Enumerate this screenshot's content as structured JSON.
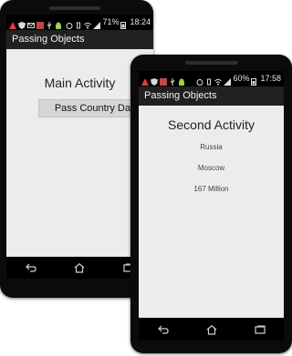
{
  "main_device": {
    "status": {
      "battery": "71%",
      "time": "18:24"
    },
    "app_title": "Passing Objects",
    "heading": "Main Activity",
    "button_label": "Pass Country Data"
  },
  "second_device": {
    "status": {
      "battery": "60%",
      "time": "17:58"
    },
    "app_title": "Passing Objects",
    "heading": "Second Activity",
    "country": "Russia",
    "capital": "Moscow",
    "population": "167 Million"
  },
  "icons": {
    "nav": [
      "back-icon",
      "home-icon",
      "recents-icon"
    ]
  },
  "colors": {
    "screen_bg": "#ececec",
    "action_bar": "#212121",
    "status_bar": "#000000",
    "button_bg": "#d6d6d6"
  }
}
